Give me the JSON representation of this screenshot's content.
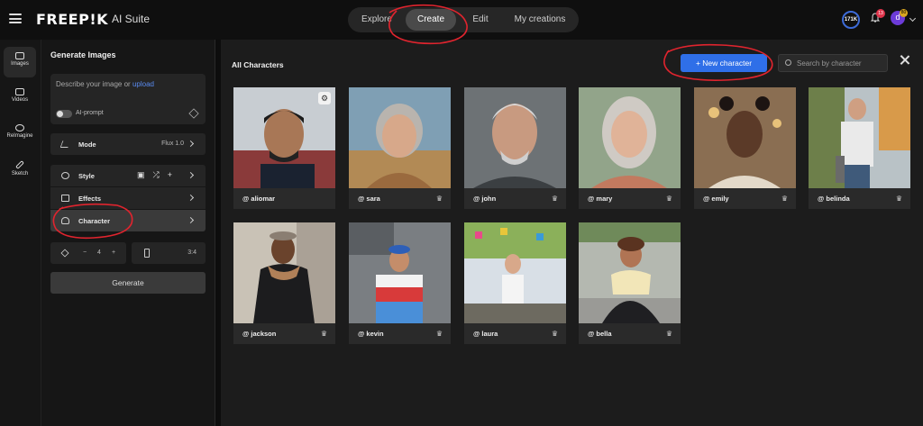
{
  "header": {
    "logo": "FREEP!K",
    "suite": "AI Suite",
    "nav": [
      "Explore",
      "Create",
      "Edit",
      "My creations"
    ],
    "active_nav": "Create",
    "credits": "171K",
    "notifications": "13",
    "avatar_letter": "d",
    "avatar_badge": "80"
  },
  "rail": [
    {
      "label": "Images",
      "icon": "images-icon"
    },
    {
      "label": "Videos",
      "icon": "videos-icon"
    },
    {
      "label": "ReImagine",
      "icon": "reimagine-icon"
    },
    {
      "label": "Sketch",
      "icon": "sketch-icon"
    }
  ],
  "panel": {
    "title": "Generate Images",
    "prompt_text": "Describe your image or",
    "prompt_link": "upload",
    "ai_prompt": "AI-prompt",
    "mode_label": "Mode",
    "mode_value": "Flux 1.0",
    "style_label": "Style",
    "effects_label": "Effects",
    "character_label": "Character",
    "count_minus": "−",
    "count": "4",
    "count_plus": "+",
    "ratio": "3:4",
    "generate": "Generate"
  },
  "main": {
    "title": "All Characters",
    "new_character": "+ New character",
    "search_placeholder": "Search by character"
  },
  "characters": [
    "@ aliomar",
    "@ sara",
    "@ john",
    "@ mary",
    "@ emily",
    "@ belinda",
    "@ jackson",
    "@ kevin",
    "@ laura",
    "@ bella"
  ],
  "colors": {
    "accent": "#2f6fe8",
    "annotation": "#e0242e"
  }
}
